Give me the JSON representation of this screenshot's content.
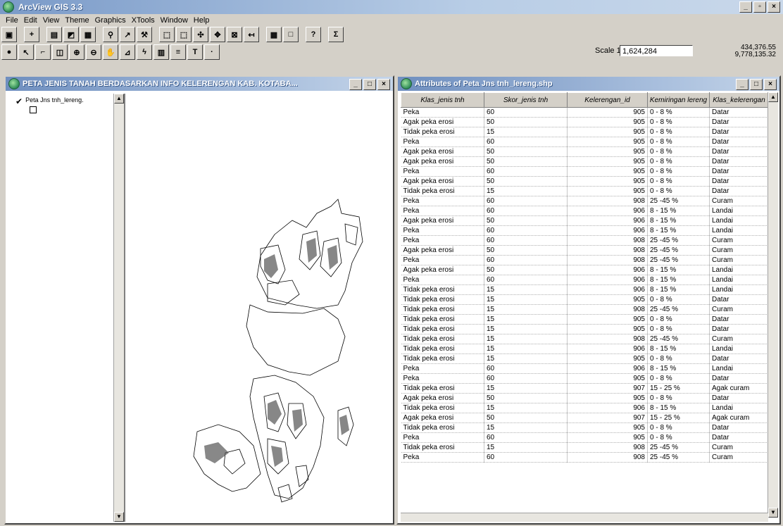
{
  "app": {
    "title": "ArcView GIS 3.3"
  },
  "menu": [
    "File",
    "Edit",
    "View",
    "Theme",
    "Graphics",
    "XTools",
    "Window",
    "Help"
  ],
  "scale": {
    "label": "Scale 1:",
    "value": "1,624,284"
  },
  "coords": {
    "x": "434,376.55",
    "y": "9,778,135.32"
  },
  "view_window": {
    "title": "PETA JENIS TANAH BERDASARKAN INFO KELERENGAN KAB. KOTABA...",
    "toc_layer": "Peta Jns tnh_lereng."
  },
  "table_window": {
    "title": "Attributes of Peta Jns tnh_lereng.shp",
    "headers": [
      "Klas_jenis tnh",
      "Skor_jenis tnh",
      "Kelerengan_id",
      "Kemiringan lereng",
      "Klas_kelerengan"
    ],
    "rows": [
      [
        "Peka",
        "60",
        "905",
        "0 - 8 %",
        "Datar"
      ],
      [
        "Agak peka erosi",
        "50",
        "905",
        "0 - 8 %",
        "Datar"
      ],
      [
        "Tidak peka erosi",
        "15",
        "905",
        "0 - 8 %",
        "Datar"
      ],
      [
        "Peka",
        "60",
        "905",
        "0 - 8 %",
        "Datar"
      ],
      [
        "Agak peka erosi",
        "50",
        "905",
        "0 - 8 %",
        "Datar"
      ],
      [
        "Agak peka erosi",
        "50",
        "905",
        "0 - 8 %",
        "Datar"
      ],
      [
        "Peka",
        "60",
        "905",
        "0 - 8 %",
        "Datar"
      ],
      [
        "Agak peka erosi",
        "50",
        "905",
        "0 - 8 %",
        "Datar"
      ],
      [
        "Tidak peka erosi",
        "15",
        "905",
        "0 - 8 %",
        "Datar"
      ],
      [
        "Peka",
        "60",
        "908",
        "25 -45 %",
        "Curam"
      ],
      [
        "Peka",
        "60",
        "906",
        "8 - 15 %",
        "Landai"
      ],
      [
        "Agak peka erosi",
        "50",
        "906",
        "8 - 15 %",
        "Landai"
      ],
      [
        "Peka",
        "60",
        "906",
        "8 - 15 %",
        "Landai"
      ],
      [
        "Peka",
        "60",
        "908",
        "25 -45 %",
        "Curam"
      ],
      [
        "Agak peka erosi",
        "50",
        "908",
        "25 -45 %",
        "Curam"
      ],
      [
        "Peka",
        "60",
        "908",
        "25 -45 %",
        "Curam"
      ],
      [
        "Agak peka erosi",
        "50",
        "906",
        "8 - 15 %",
        "Landai"
      ],
      [
        "Peka",
        "60",
        "906",
        "8 - 15 %",
        "Landai"
      ],
      [
        "Tidak peka erosi",
        "15",
        "906",
        "8 - 15 %",
        "Landai"
      ],
      [
        "Tidak peka erosi",
        "15",
        "905",
        "0 - 8 %",
        "Datar"
      ],
      [
        "Tidak peka erosi",
        "15",
        "908",
        "25 -45 %",
        "Curam"
      ],
      [
        "Tidak peka erosi",
        "15",
        "905",
        "0 - 8 %",
        "Datar"
      ],
      [
        "Tidak peka erosi",
        "15",
        "905",
        "0 - 8 %",
        "Datar"
      ],
      [
        "Tidak peka erosi",
        "15",
        "908",
        "25 -45 %",
        "Curam"
      ],
      [
        "Tidak peka erosi",
        "15",
        "906",
        "8 - 15 %",
        "Landai"
      ],
      [
        "Tidak peka erosi",
        "15",
        "905",
        "0 - 8 %",
        "Datar"
      ],
      [
        "Peka",
        "60",
        "906",
        "8 - 15 %",
        "Landai"
      ],
      [
        "Peka",
        "60",
        "905",
        "0 - 8 %",
        "Datar"
      ],
      [
        "Tidak peka erosi",
        "15",
        "907",
        "15 - 25 %",
        "Agak curam"
      ],
      [
        "Agak peka erosi",
        "50",
        "905",
        "0 - 8 %",
        "Datar"
      ],
      [
        "Tidak peka erosi",
        "15",
        "906",
        "8 - 15 %",
        "Landai"
      ],
      [
        "Agak peka erosi",
        "50",
        "907",
        "15 - 25 %",
        "Agak curam"
      ],
      [
        "Tidak peka erosi",
        "15",
        "905",
        "0 - 8 %",
        "Datar"
      ],
      [
        "Peka",
        "60",
        "905",
        "0 - 8 %",
        "Datar"
      ],
      [
        "Tidak peka erosi",
        "15",
        "908",
        "25 -45 %",
        "Curam"
      ],
      [
        "Peka",
        "60",
        "908",
        "25 -45 %",
        "Curam"
      ]
    ]
  }
}
